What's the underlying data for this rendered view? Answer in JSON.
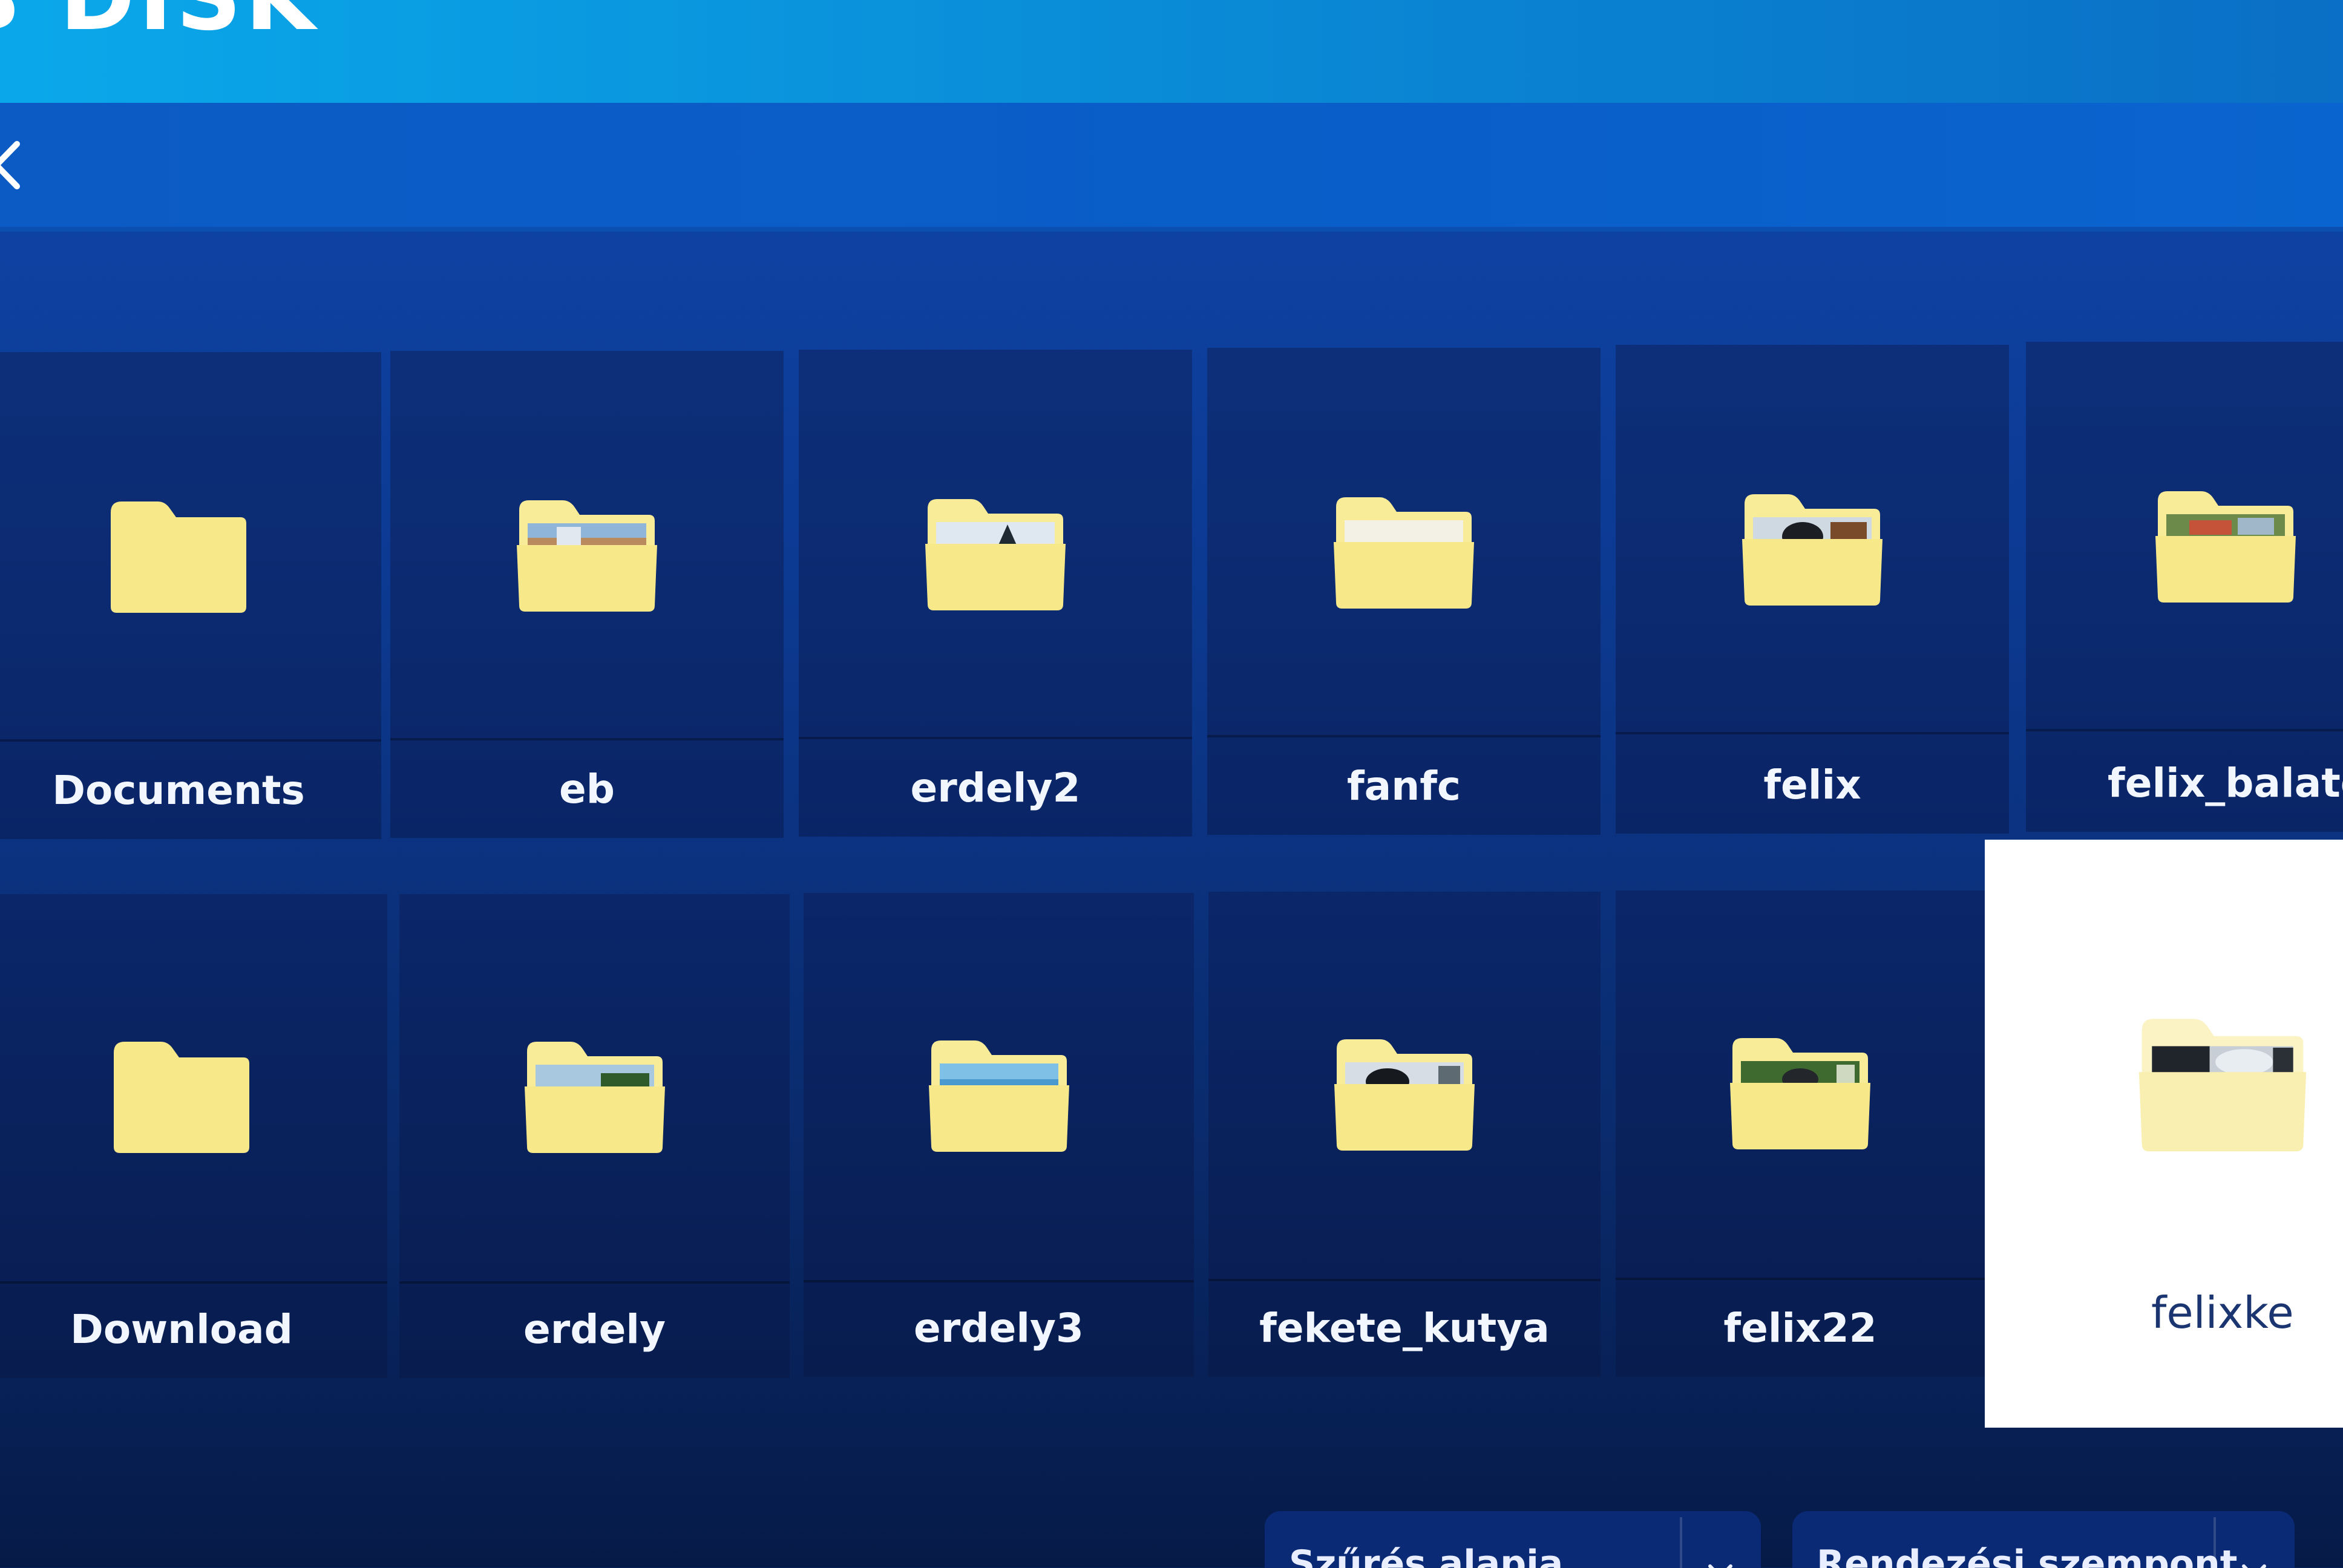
{
  "header": {
    "title": "B DISK"
  },
  "navigation": {
    "back_icon": "chevron-left-icon"
  },
  "folders": [
    {
      "name": "Documents",
      "has_preview": false,
      "selected": false
    },
    {
      "name": "eb",
      "has_preview": true,
      "selected": false
    },
    {
      "name": "erdely2",
      "has_preview": true,
      "selected": false
    },
    {
      "name": "fanfc",
      "has_preview": false,
      "selected": false
    },
    {
      "name": "felix",
      "has_preview": true,
      "selected": false
    },
    {
      "name": "felix_balaton",
      "has_preview": true,
      "selected": false
    },
    {
      "name": "Download",
      "has_preview": false,
      "selected": false
    },
    {
      "name": "erdely",
      "has_preview": true,
      "selected": false
    },
    {
      "name": "erdely3",
      "has_preview": true,
      "selected": false
    },
    {
      "name": "fekete_kutya",
      "has_preview": true,
      "selected": false
    },
    {
      "name": "felix22",
      "has_preview": true,
      "selected": false
    },
    {
      "name": "felixke",
      "has_preview": true,
      "selected": true
    }
  ],
  "toolbar": {
    "filter_label": "Szűrés alapja",
    "sort_label": "Rendezési szempont"
  },
  "colors": {
    "folder": "#f7e98a",
    "folder_tab": "#f9ec98",
    "header": "#0a8bd6",
    "background": "#0c3a93",
    "tile": "#0d2f7a",
    "selected_tile": "#ffffff"
  }
}
